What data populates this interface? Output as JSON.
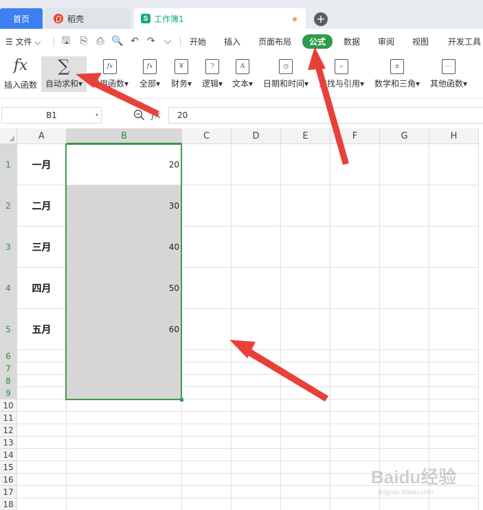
{
  "tabs": {
    "home": "首页",
    "daoke": "稻壳",
    "workbook": "工作簿1",
    "workbook_icon": "S"
  },
  "menubar": {
    "file": "文件",
    "items": [
      "开始",
      "插入",
      "页面布局",
      "公式",
      "数据",
      "审阅",
      "视图",
      "开发工具"
    ],
    "active": "公式",
    "active_color": "#2e9b4a"
  },
  "ribbon": {
    "buttons": [
      "插入函数",
      "自动求和",
      "常用函数",
      "全部",
      "财务",
      "逻辑",
      "文本",
      "日期和时间",
      "查找与引用",
      "数学和三角",
      "其他函数"
    ],
    "dropdown": "▾"
  },
  "formula_bar": {
    "name_box": "B1",
    "fx": "fx",
    "content": "20"
  },
  "sheet": {
    "columns": [
      "A",
      "B",
      "C",
      "D",
      "E",
      "F",
      "G",
      "H"
    ],
    "rows": [
      "1",
      "2",
      "3",
      "4",
      "5",
      "6",
      "7",
      "8",
      "9",
      "10",
      "11",
      "12",
      "13",
      "14",
      "15",
      "16",
      "17",
      "18"
    ],
    "months": [
      "一月",
      "二月",
      "三月",
      "四月",
      "五月"
    ],
    "values": [
      "20",
      "30",
      "40",
      "50",
      "60"
    ],
    "selection": "B1:B9",
    "selection_color": "#3d9a4d"
  },
  "watermark": {
    "main": "Baidu经验",
    "sub": "jingyan.baidu.com"
  },
  "annotation_color": "#e8413a"
}
